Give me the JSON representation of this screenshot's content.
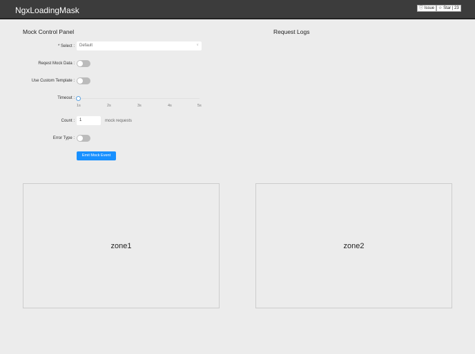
{
  "header": {
    "title": "NgxLoadingMask",
    "issue_label": "Issue",
    "star_label": "Star",
    "star_count": "23"
  },
  "panel": {
    "title": "Mock Control Panel",
    "select_label": "* Select :",
    "select_value": "Default",
    "mock_data_label": "Reqest Mock Data :",
    "custom_template_label": "Use Custom Template :",
    "timeout_label": "Timeout :",
    "timeout_ticks": [
      "1s",
      "2s",
      "3s",
      "4s",
      "5s"
    ],
    "timeout_value": "1s",
    "count_label": "Count :",
    "count_value": "1",
    "count_suffix": "mock requests",
    "error_label": "Error Type :",
    "emit_label": "Emit Mock Event"
  },
  "logs": {
    "title": "Request Logs"
  },
  "zones": [
    "zone1",
    "zone2"
  ]
}
